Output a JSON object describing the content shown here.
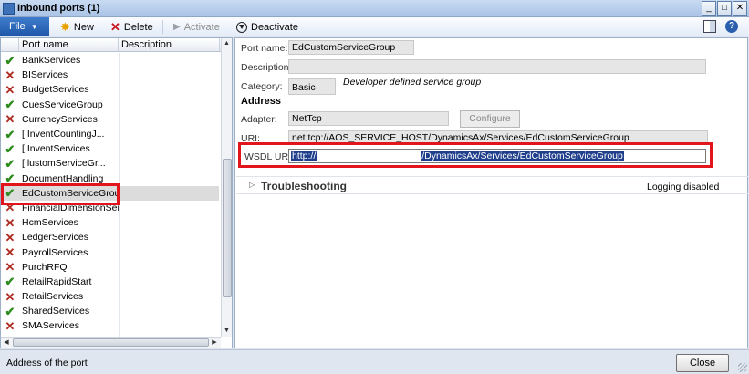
{
  "window": {
    "title": "Inbound ports (1)",
    "min": "_",
    "max": "□",
    "close": "✕"
  },
  "toolbar": {
    "file": "File",
    "new": "New",
    "delete": "Delete",
    "activate": "Activate",
    "deactivate": "Deactivate"
  },
  "grid": {
    "columns": [
      "Port name",
      "Description"
    ],
    "rows": [
      {
        "name": "BankServices",
        "status": "active"
      },
      {
        "name": "BIServices",
        "status": "inactive"
      },
      {
        "name": "BudgetServices",
        "status": "inactive"
      },
      {
        "name": "CuesServiceGroup",
        "status": "active"
      },
      {
        "name": "CurrencyServices",
        "status": "inactive"
      },
      {
        "name": "[        InventCountingJ...",
        "status": "active"
      },
      {
        "name": "[        InventServices",
        "status": "active"
      },
      {
        "name": "[        lustomServiceGr...",
        "status": "active"
      },
      {
        "name": "DocumentHandling",
        "status": "active"
      },
      {
        "name": "EdCustomServiceGroup",
        "status": "active"
      },
      {
        "name": "FinancialDimensionSer...",
        "status": "inactive"
      },
      {
        "name": "HcmServices",
        "status": "inactive"
      },
      {
        "name": "LedgerServices",
        "status": "inactive"
      },
      {
        "name": "PayrollServices",
        "status": "inactive"
      },
      {
        "name": "PurchRFQ",
        "status": "inactive"
      },
      {
        "name": "RetailRapidStart",
        "status": "active"
      },
      {
        "name": "RetailServices",
        "status": "inactive"
      },
      {
        "name": "SharedServices",
        "status": "active"
      },
      {
        "name": "SMAServices",
        "status": "inactive"
      }
    ],
    "selected_row": 9
  },
  "details": {
    "port_name_label": "Port name:",
    "port_name_value": "EdCustomServiceGroup",
    "description_label": "Description:",
    "description_value": "",
    "category_label": "Category:",
    "category_value": "Basic",
    "category_note": "Developer defined service group",
    "address_heading": "Address",
    "adapter_label": "Adapter:",
    "adapter_value": "NetTcp",
    "configure_button": "Configure",
    "uri_label": "URI:",
    "uri_value": "net.tcp://AOS_SERVICE_HOST/DynamicsAx/Services/EdCustomServiceGroup",
    "wsdl_label": "WSDL URI:",
    "wsdl_prefix": "http://",
    "wsdl_suffix": "/DynamicsAx/Services/EdCustomServiceGroup",
    "troubleshooting_title": "Troubleshooting",
    "logging_status": "Logging disabled"
  },
  "statusbar": {
    "text": "Address of the port",
    "close_button": "Close"
  },
  "colors": {
    "highlight": "#e2141c",
    "active_check": "#2e8b1e",
    "inactive_x": "#b02a20",
    "file_button": "#1f57a8"
  }
}
